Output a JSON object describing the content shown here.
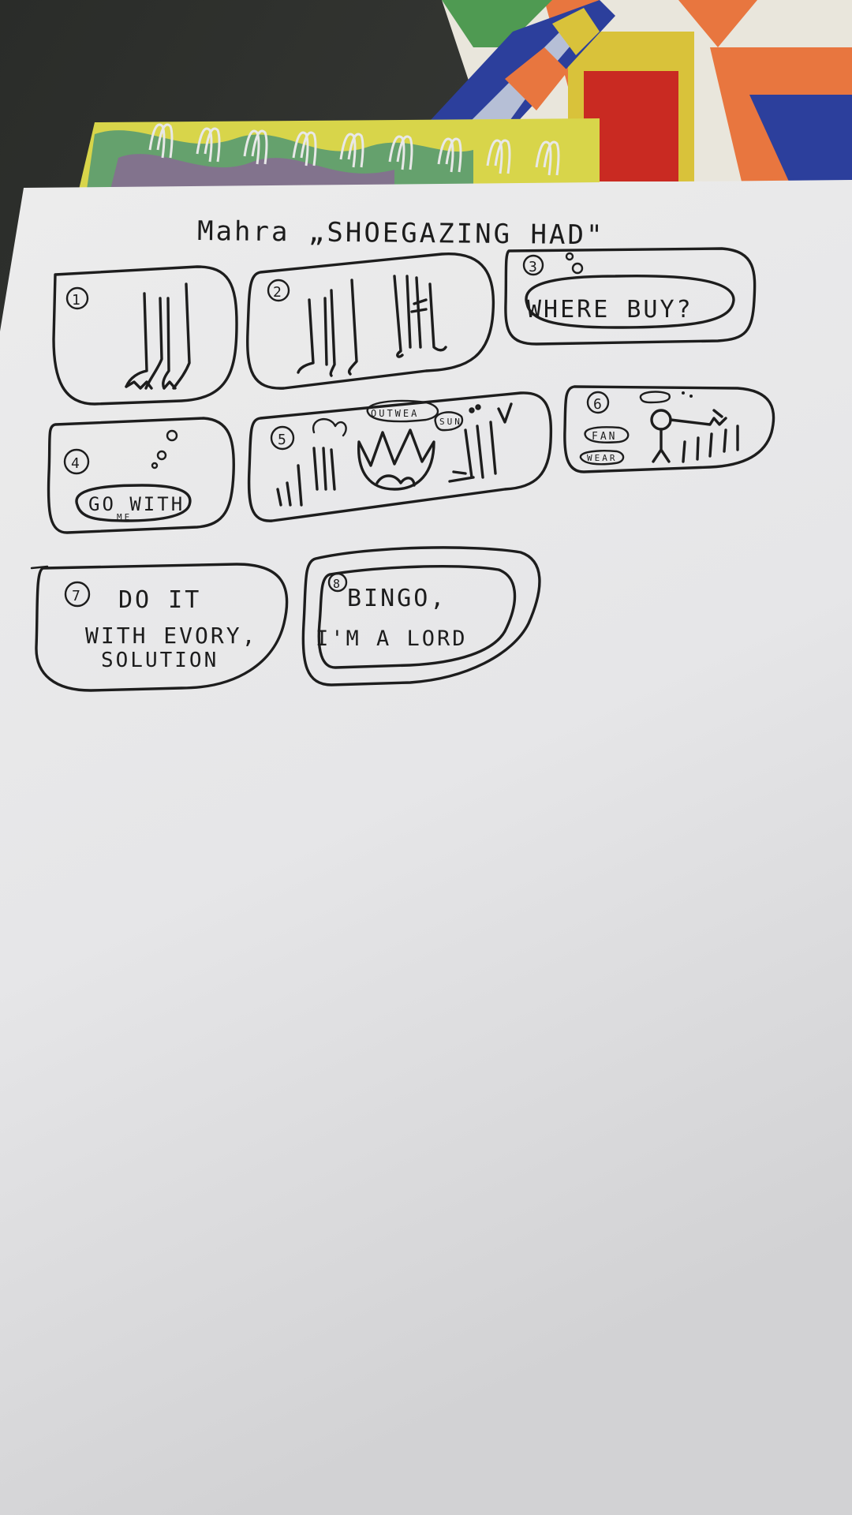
{
  "sketch": {
    "title": "Mahra „SHOEGAZING HAD\"",
    "panels": [
      {
        "number": "1",
        "text": ""
      },
      {
        "number": "2",
        "text": ""
      },
      {
        "number": "3",
        "text": "WHERE BUY?"
      },
      {
        "number": "4",
        "text": "GO WITH",
        "subtext": "ME"
      },
      {
        "number": "5",
        "bubble_a": "OUTWEA",
        "bubble_b": "SUN"
      },
      {
        "number": "6",
        "bubble_a": "FAN",
        "bubble_b": "WEAR"
      },
      {
        "number": "7",
        "line1": "DO IT",
        "line2": "WITH EVORY,",
        "line3": "SOLUTION"
      },
      {
        "number": "8",
        "line1": "BINGO,",
        "line2": "I'M A LORD"
      }
    ]
  },
  "colors": {
    "paper": "#e9e9e9",
    "ink": "#1d1d1d",
    "fabric": "#3b3d39",
    "notebook": "#d8d54a",
    "quilt_orange": "#e8763f",
    "quilt_blue": "#2c3f9c",
    "quilt_red": "#c92a22"
  }
}
